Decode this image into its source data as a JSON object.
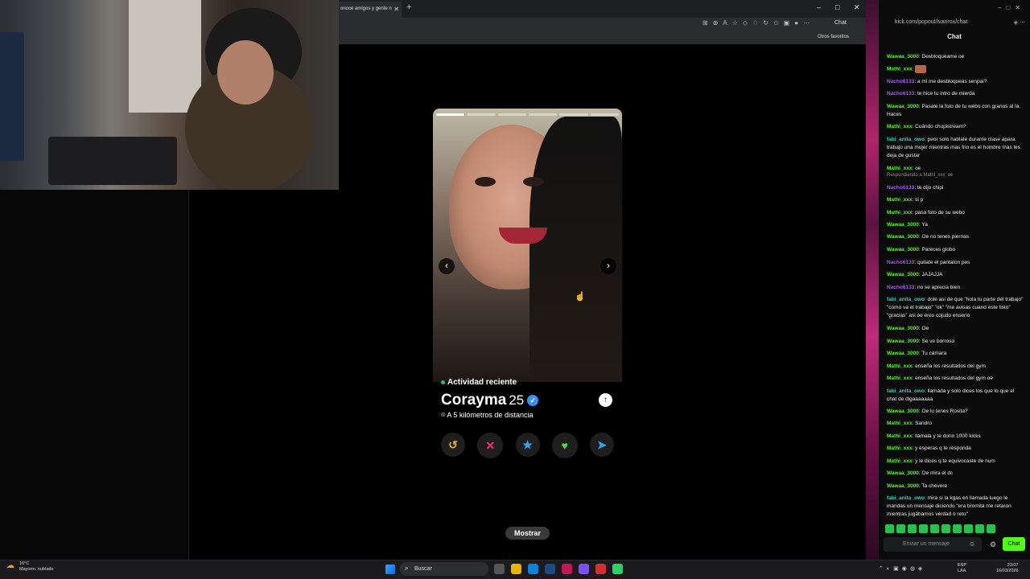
{
  "browser": {
    "tab_title": "onoce amigos y gente n",
    "tab_close": "✕",
    "new_tab": "+",
    "chat_button": "Chat",
    "bookmark_folder": "Otros favoritos"
  },
  "profile": {
    "activity": "Actividad reciente",
    "name": "Corayma",
    "age": "25",
    "distance": "A 5 kilómetros de distancia",
    "photo_count": 6,
    "current_photo": 1
  },
  "actions": {
    "rewind": "↺",
    "nope": "✕",
    "super_like": "★",
    "like": "♥",
    "boost": "➤"
  },
  "mostrar_label": "Mostrar",
  "chat": {
    "url": "kick.com/popout/ivanrox/chat",
    "title": "Chat",
    "reply_note": "Respondiendo a Mathi_xxx: oe",
    "messages": [
      {
        "user": "Wawaa_3000",
        "text": "Desbloqueame oe",
        "color": "#53fc18"
      },
      {
        "user": "Mathi_xxx",
        "text": "",
        "color": "#53fc18"
      },
      {
        "user": "Nacho6133",
        "text": "a mi me desbloqueas senpai?",
        "color": "#a855f7"
      },
      {
        "user": "Nacho6133",
        "text": "te hice tu intro de mierda",
        "color": "#a855f7"
      },
      {
        "user": "Wawaa_3000",
        "text": "Pasale la foto de tu webo con granos al la. Haces",
        "color": "#53fc18"
      },
      {
        "user": "Mathi_xxx",
        "text": "Cuándo chupistream?",
        "color": "#53fc18"
      },
      {
        "user": "fabi_anita_owo",
        "text": "peor solo hablale durante clase apara trabajo una mujer mientras mas frio es el hombre mas les deja de gustar",
        "color": "#2dd4bf"
      },
      {
        "user": "Mathi_xxx",
        "text": "oe",
        "color": "#53fc18"
      },
      {
        "user": "Nacho6133",
        "text": "te dijo chipi",
        "color": "#a855f7"
      },
      {
        "user": "Mathi_xxx",
        "text": "si p",
        "color": "#53fc18"
      },
      {
        "user": "Mathi_xxx",
        "text": "pasa foto de su webo",
        "color": "#53fc18"
      },
      {
        "user": "Wawaa_3000",
        "text": "Ya",
        "color": "#53fc18"
      },
      {
        "user": "Wawaa_3000",
        "text": "Oe no tenes piernas",
        "color": "#53fc18"
      },
      {
        "user": "Wawaa_3000",
        "text": "Pareces globo",
        "color": "#53fc18"
      },
      {
        "user": "Nacho6133",
        "text": "quitate el pantalon pes",
        "color": "#a855f7"
      },
      {
        "user": "Wawaa_3000",
        "text": "JAJAJJA",
        "color": "#53fc18"
      },
      {
        "user": "Nacho6133",
        "text": "no se aprecia bien",
        "color": "#a855f7"
      },
      {
        "user": "fabi_anita_owo",
        "text": "dole asi de que \"hola tu parte del trabajo\" \"como va el trabajo\" \"ok\" \"me avisas cuand este listo\" \"gracias\" asi oe eres cojudo enserio",
        "color": "#2dd4bf"
      },
      {
        "user": "Wawaa_3000",
        "text": "Oe",
        "color": "#53fc18"
      },
      {
        "user": "Wawaa_3000",
        "text": "Se ve borroso",
        "color": "#53fc18"
      },
      {
        "user": "Wawaa_3000",
        "text": "Tu cámara",
        "color": "#53fc18"
      },
      {
        "user": "Mathi_xxx",
        "text": "enseña los resultados del gym",
        "color": "#53fc18"
      },
      {
        "user": "Mathi_xxx",
        "text": "enseña los resultados del gym oe",
        "color": "#53fc18"
      },
      {
        "user": "fabi_anita_owo",
        "text": "llamada y solo dices los que lo que el chat de digaaaaaaa",
        "color": "#2dd4bf"
      },
      {
        "user": "Wawaa_3000",
        "text": "Oe lo tenes Rosita?",
        "color": "#53fc18"
      },
      {
        "user": "Mathi_xxx",
        "text": "Sandro",
        "color": "#53fc18"
      },
      {
        "user": "Mathi_xxx",
        "text": "llámala y te dono 1000 kicks",
        "color": "#53fc18"
      },
      {
        "user": "Mathi_xxx",
        "text": "y esperas q te responda",
        "color": "#53fc18"
      },
      {
        "user": "Mathi_xxx",
        "text": "y le dices q te equivocaste de num",
        "color": "#53fc18"
      },
      {
        "user": "Wawaa_3000",
        "text": "Oe mira el dc",
        "color": "#53fc18"
      },
      {
        "user": "Wawaa_3000",
        "text": "Ta chevere",
        "color": "#53fc18"
      },
      {
        "user": "fabi_anita_owo",
        "text": "mira si la kgas en llamada luego le mandas un mensaje diciendo \"era bromita me retaron mientras jugábamos verdad o reto\"",
        "color": "#2dd4bf"
      }
    ],
    "input_placeholder": "Enviar un mensaje",
    "send_label": "Chat"
  },
  "taskbar": {
    "weather_temp": "16°C",
    "weather_desc": "Mayorm. nublado",
    "search_label": "Buscar",
    "lang_top": "ESP",
    "lang_bottom": "LAA",
    "time": "23:07",
    "date": "16/03/2026"
  }
}
